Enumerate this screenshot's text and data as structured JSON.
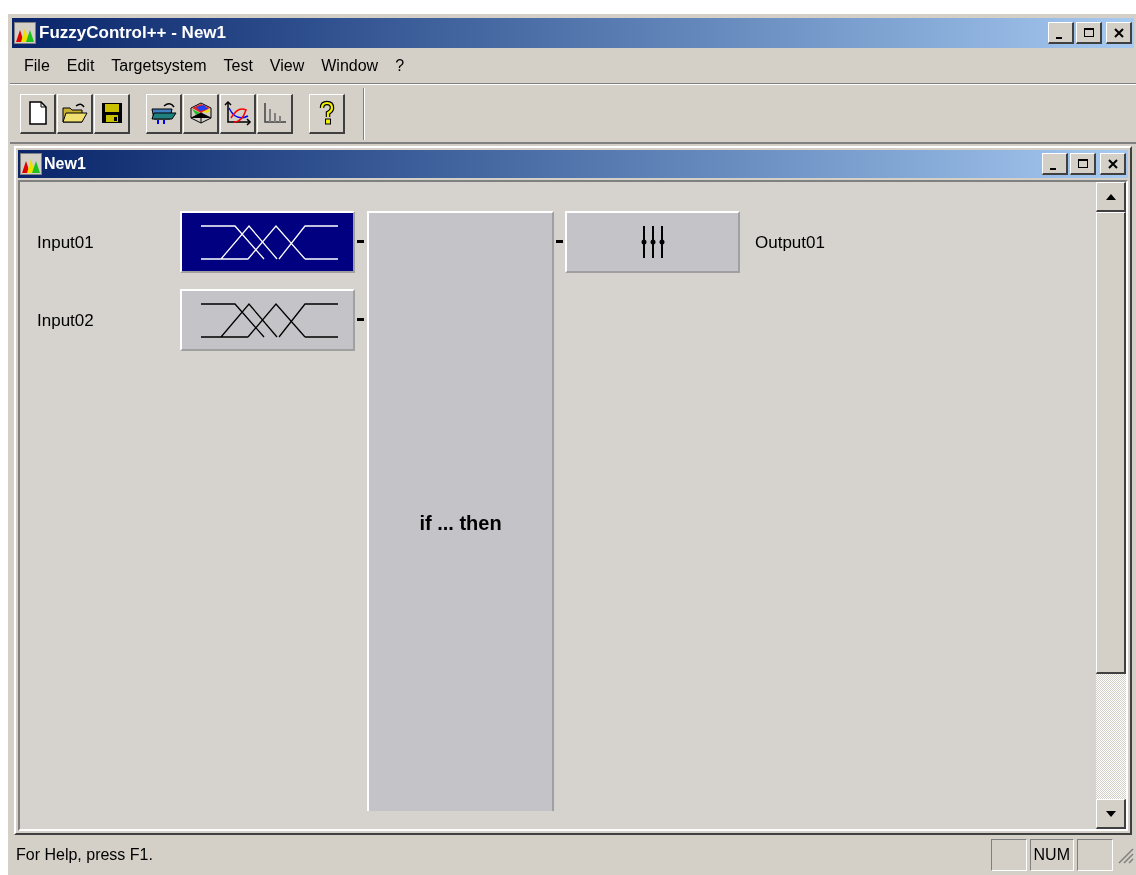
{
  "window": {
    "title": "FuzzyControl++ - New1"
  },
  "menu": [
    "File",
    "Edit",
    "Targetsystem",
    "Test",
    "View",
    "Window",
    "?"
  ],
  "toolbar": {
    "groups": [
      [
        {
          "kind": "new"
        },
        {
          "kind": "open"
        },
        {
          "kind": "save"
        }
      ],
      [
        {
          "kind": "import"
        },
        {
          "kind": "surface"
        },
        {
          "kind": "curve"
        },
        {
          "kind": "histogram"
        }
      ],
      [
        {
          "kind": "help"
        }
      ]
    ]
  },
  "child_window": {
    "title": "New1"
  },
  "diagram": {
    "inputs": [
      {
        "label": "Input01",
        "selected": true
      },
      {
        "label": "Input02",
        "selected": false
      }
    ],
    "rule_block": {
      "label": "if ... then"
    },
    "outputs": [
      {
        "label": "Output01",
        "selected": false
      }
    ]
  },
  "status_bar": {
    "text": "For Help, press F1.",
    "indicators": [
      {
        "kind": "blank"
      },
      {
        "kind": "text",
        "label": "NUM"
      },
      {
        "kind": "blank"
      }
    ]
  }
}
